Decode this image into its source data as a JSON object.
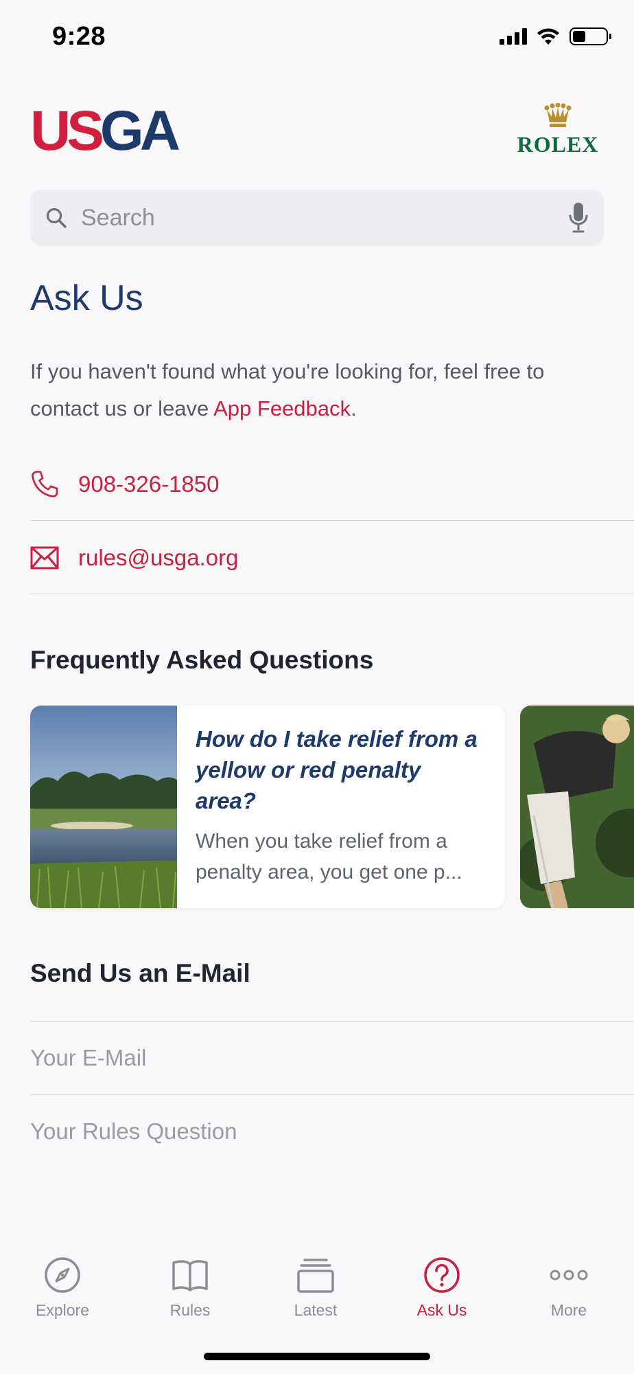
{
  "status_bar": {
    "time": "9:28",
    "battery_level": 0.4
  },
  "header": {
    "logo_usga_u": "US",
    "logo_usga_ga": "GA",
    "logo_rolex": "ROLEX",
    "colors": {
      "usga_red": "#d21f3c",
      "usga_navy": "#1d3a6b",
      "rolex_green": "#0c6b3a"
    }
  },
  "search": {
    "placeholder": "Search",
    "icons": [
      "search-icon",
      "microphone-icon"
    ]
  },
  "ask_us": {
    "title": "Ask Us",
    "intro_text": "If you haven't found what you're looking for, feel free to contact us or leave ",
    "intro_link": "App Feedback",
    "intro_end": ".",
    "phone": "908-326-1850",
    "email": "rules@usga.org",
    "accent_color": "#c9203f"
  },
  "faq": {
    "title": "Frequently Asked Questions",
    "cards": [
      {
        "question": "How do I take relief from a yellow or red penalty area?",
        "preview": "When you take relief from a penalty area, you get one p..."
      }
    ]
  },
  "send_email": {
    "title": "Send Us an E-Mail",
    "email_placeholder": "Your E-Mail",
    "question_placeholder": "Your Rules Question"
  },
  "tabs": [
    {
      "label": "Explore",
      "icon": "compass-icon",
      "active": false
    },
    {
      "label": "Rules",
      "icon": "book-icon",
      "active": false
    },
    {
      "label": "Latest",
      "icon": "stack-icon",
      "active": false
    },
    {
      "label": "Ask Us",
      "icon": "question-circle-icon",
      "active": true
    },
    {
      "label": "More",
      "icon": "more-dots-icon",
      "active": false
    }
  ]
}
